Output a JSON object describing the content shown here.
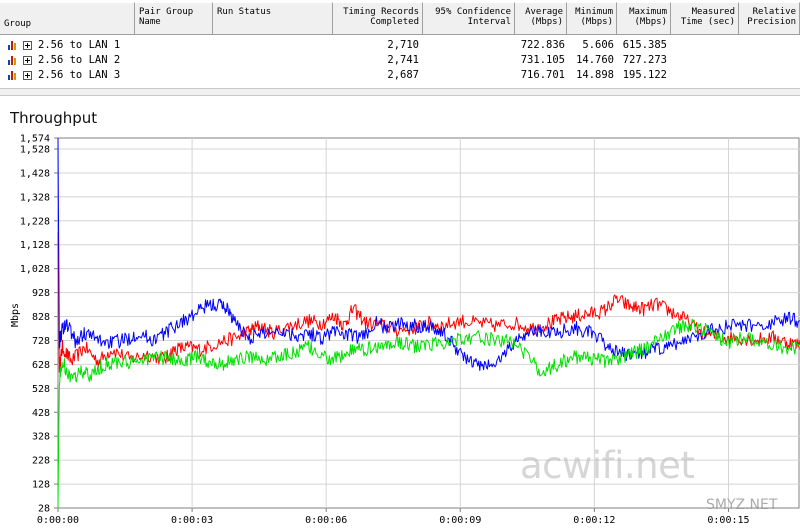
{
  "table": {
    "headers": [
      {
        "label": "Group",
        "left": 0,
        "width": 135,
        "align": "l",
        "pad": 17
      },
      {
        "label": "Pair Group Name",
        "left": 135,
        "width": 78,
        "align": "l",
        "pad": 4
      },
      {
        "label": "Run Status",
        "left": 213,
        "width": 120,
        "align": "l",
        "pad": 4
      },
      {
        "label": "Timing Records Completed",
        "left": 333,
        "width": 90,
        "align": "r",
        "pad": 4
      },
      {
        "label": "95% Confidence Interval",
        "left": 423,
        "width": 92,
        "align": "r",
        "pad": 4
      },
      {
        "label": "Average (Mbps)",
        "left": 515,
        "width": 52,
        "align": "r",
        "pad": 4
      },
      {
        "label": "Minimum (Mbps)",
        "left": 567,
        "width": 50,
        "align": "r",
        "pad": 4
      },
      {
        "label": "Maximum (Mbps)",
        "left": 617,
        "width": 54,
        "align": "r",
        "pad": 4
      },
      {
        "label": "Measured Time (sec)",
        "left": 671,
        "width": 68,
        "align": "r",
        "pad": 4
      },
      {
        "label": "Relative Precision",
        "left": 739,
        "width": 61,
        "align": "r",
        "pad": 4
      }
    ],
    "rows": [
      {
        "group": "2.56 to LAN 1",
        "records": "2,710",
        "average": "722.836",
        "minimum": "5.606",
        "maximum": "615.385"
      },
      {
        "group": "2.56 to LAN 2",
        "records": "2,741",
        "average": "731.105",
        "minimum": "14.760",
        "maximum": "727.273"
      },
      {
        "group": "2.56 to LAN 3",
        "records": "2,687",
        "average": "716.701",
        "minimum": "14.898",
        "maximum": "195.122"
      }
    ]
  },
  "chart_data": {
    "type": "line",
    "title": "Throughput",
    "ylabel": "Mbps",
    "xlabel": "",
    "ylim": [
      28,
      1574
    ],
    "xlim": [
      0,
      16.6
    ],
    "yticks": [
      1574,
      1528,
      1428,
      1328,
      1228,
      1128,
      1028,
      928,
      828,
      728,
      628,
      528,
      428,
      328,
      228,
      128,
      28
    ],
    "ytick_labels": [
      "1,574",
      "1,528",
      "1,428",
      "1,328",
      "1,228",
      "1,128",
      "1,028",
      "928",
      "828",
      "728",
      "628",
      "528",
      "428",
      "328",
      "228",
      "128",
      "28"
    ],
    "xticks": [
      0,
      3,
      6,
      9,
      12,
      15
    ],
    "xtick_labels": [
      "0:00:00",
      "0:00:03",
      "0:00:06",
      "0:00:09",
      "0:00:12",
      "0:00:15"
    ],
    "grid": true,
    "series": [
      {
        "color": "#ff0000",
        "points": [
          [
            0,
            1180
          ],
          [
            0.03,
            620
          ],
          [
            0.1,
            700
          ],
          [
            0.3,
            640
          ],
          [
            0.6,
            700
          ],
          [
            0.9,
            640
          ],
          [
            1.2,
            690
          ],
          [
            1.6,
            650
          ],
          [
            2.0,
            670
          ],
          [
            2.4,
            650
          ],
          [
            2.6,
            690
          ],
          [
            2.9,
            700
          ],
          [
            3.2,
            690
          ],
          [
            3.6,
            720
          ],
          [
            4.0,
            740
          ],
          [
            4.3,
            770
          ],
          [
            4.5,
            790
          ],
          [
            4.8,
            760
          ],
          [
            5.2,
            790
          ],
          [
            5.6,
            810
          ],
          [
            5.9,
            800
          ],
          [
            6.2,
            830
          ],
          [
            6.4,
            790
          ],
          [
            6.6,
            860
          ],
          [
            6.9,
            800
          ],
          [
            7.3,
            790
          ],
          [
            7.6,
            770
          ],
          [
            8.0,
            780
          ],
          [
            8.3,
            800
          ],
          [
            8.6,
            790
          ],
          [
            9.0,
            810
          ],
          [
            9.4,
            800
          ],
          [
            9.8,
            790
          ],
          [
            10.2,
            800
          ],
          [
            10.6,
            780
          ],
          [
            11.0,
            800
          ],
          [
            11.3,
            820
          ],
          [
            11.6,
            830
          ],
          [
            11.9,
            840
          ],
          [
            12.2,
            850
          ],
          [
            12.5,
            900
          ],
          [
            12.8,
            870
          ],
          [
            13.1,
            860
          ],
          [
            13.4,
            880
          ],
          [
            13.7,
            850
          ],
          [
            14.0,
            820
          ],
          [
            14.4,
            760
          ],
          [
            14.8,
            740
          ],
          [
            15.2,
            740
          ],
          [
            15.6,
            730
          ],
          [
            16.0,
            740
          ],
          [
            16.3,
            720
          ],
          [
            16.6,
            710
          ]
        ]
      },
      {
        "color": "#0000ff",
        "points": [
          [
            0,
            1574
          ],
          [
            0.03,
            720
          ],
          [
            0.1,
            780
          ],
          [
            0.2,
            800
          ],
          [
            0.4,
            720
          ],
          [
            0.6,
            760
          ],
          [
            0.9,
            730
          ],
          [
            1.2,
            720
          ],
          [
            1.5,
            730
          ],
          [
            1.8,
            760
          ],
          [
            2.1,
            730
          ],
          [
            2.4,
            760
          ],
          [
            2.7,
            800
          ],
          [
            3.0,
            830
          ],
          [
            3.3,
            870
          ],
          [
            3.6,
            880
          ],
          [
            3.8,
            860
          ],
          [
            4.0,
            790
          ],
          [
            4.3,
            740
          ],
          [
            4.6,
            760
          ],
          [
            5.0,
            770
          ],
          [
            5.3,
            750
          ],
          [
            5.6,
            760
          ],
          [
            5.9,
            740
          ],
          [
            6.2,
            770
          ],
          [
            6.5,
            750
          ],
          [
            6.8,
            740
          ],
          [
            7.1,
            800
          ],
          [
            7.4,
            780
          ],
          [
            7.7,
            800
          ],
          [
            8.0,
            790
          ],
          [
            8.3,
            790
          ],
          [
            8.6,
            760
          ],
          [
            8.9,
            700
          ],
          [
            9.2,
            640
          ],
          [
            9.5,
            620
          ],
          [
            9.8,
            630
          ],
          [
            10.1,
            700
          ],
          [
            10.4,
            750
          ],
          [
            10.7,
            770
          ],
          [
            11.0,
            760
          ],
          [
            11.3,
            770
          ],
          [
            11.6,
            780
          ],
          [
            11.9,
            760
          ],
          [
            12.2,
            720
          ],
          [
            12.5,
            680
          ],
          [
            12.8,
            660
          ],
          [
            13.1,
            680
          ],
          [
            13.4,
            690
          ],
          [
            13.7,
            700
          ],
          [
            14.0,
            730
          ],
          [
            14.4,
            760
          ],
          [
            14.8,
            780
          ],
          [
            15.2,
            790
          ],
          [
            15.6,
            790
          ],
          [
            16.0,
            800
          ],
          [
            16.3,
            820
          ],
          [
            16.6,
            810
          ]
        ]
      },
      {
        "color": "#00e000",
        "points": [
          [
            0,
            28
          ],
          [
            0.03,
            560
          ],
          [
            0.1,
            640
          ],
          [
            0.3,
            560
          ],
          [
            0.5,
            600
          ],
          [
            0.7,
            580
          ],
          [
            1.0,
            620
          ],
          [
            1.3,
            640
          ],
          [
            1.6,
            630
          ],
          [
            1.9,
            650
          ],
          [
            2.2,
            660
          ],
          [
            2.5,
            650
          ],
          [
            2.8,
            640
          ],
          [
            3.1,
            660
          ],
          [
            3.4,
            640
          ],
          [
            3.7,
            630
          ],
          [
            4.0,
            650
          ],
          [
            4.3,
            660
          ],
          [
            4.6,
            650
          ],
          [
            5.0,
            660
          ],
          [
            5.3,
            680
          ],
          [
            5.6,
            700
          ],
          [
            5.9,
            660
          ],
          [
            6.2,
            650
          ],
          [
            6.5,
            680
          ],
          [
            6.8,
            690
          ],
          [
            7.1,
            700
          ],
          [
            7.4,
            710
          ],
          [
            7.7,
            720
          ],
          [
            8.0,
            700
          ],
          [
            8.3,
            710
          ],
          [
            8.6,
            720
          ],
          [
            9.0,
            740
          ],
          [
            9.4,
            740
          ],
          [
            9.8,
            730
          ],
          [
            10.2,
            720
          ],
          [
            10.5,
            660
          ],
          [
            10.8,
            600
          ],
          [
            11.1,
            620
          ],
          [
            11.4,
            650
          ],
          [
            11.7,
            660
          ],
          [
            12.0,
            650
          ],
          [
            12.3,
            640
          ],
          [
            12.6,
            660
          ],
          [
            12.9,
            680
          ],
          [
            13.2,
            700
          ],
          [
            13.5,
            740
          ],
          [
            13.8,
            780
          ],
          [
            14.1,
            790
          ],
          [
            14.4,
            780
          ],
          [
            14.7,
            750
          ],
          [
            15.0,
            720
          ],
          [
            15.4,
            740
          ],
          [
            15.8,
            720
          ],
          [
            16.2,
            700
          ],
          [
            16.6,
            690
          ]
        ]
      }
    ]
  },
  "watermark": "acwifi.net",
  "corner_mark": "SMYZ.NET"
}
